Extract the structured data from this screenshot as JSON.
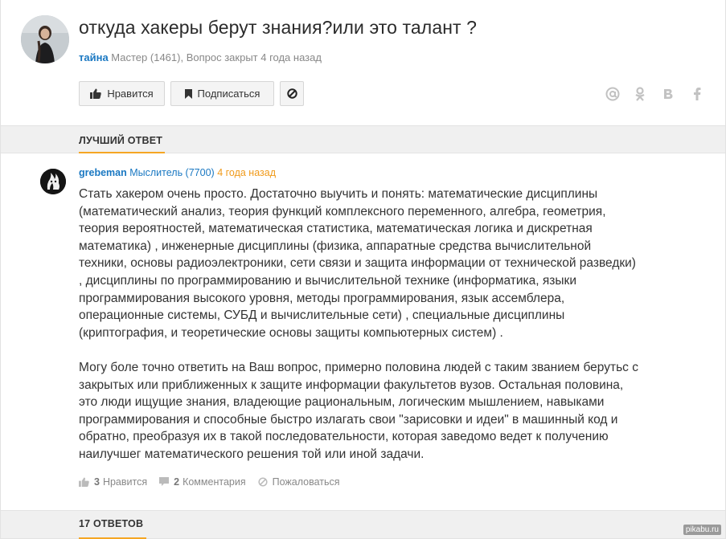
{
  "question": {
    "title": "откуда хакеры берут знания?или это талант ?",
    "author": "тайна",
    "author_rank": "Мастер (1461),",
    "status": "Вопрос закрыт 4 года назад"
  },
  "toolbar": {
    "like_label": "Нравится",
    "subscribe_label": "Подписаться",
    "block_icon": "block-icon"
  },
  "share": {
    "icons": [
      "at-icon",
      "odnoklassniki-icon",
      "vkontakte-icon",
      "facebook-icon"
    ],
    "glyphs": [
      "@",
      "♀",
      "в",
      "f"
    ]
  },
  "best_answer": {
    "section_label": "ЛУЧШИЙ ОТВЕТ",
    "author": "grebeman",
    "author_rank": "Мыслитель (7700)",
    "time": "4 года назад",
    "paragraph1": "Стать хакером очень просто. Достаточно выучить и понять: математические дисциплины (математический анализ, теория функций комплексного переменного, алгебра, геометрия, теория вероятностей, математическая статистика, математическая логика и дискретная математика) , инженерные дисциплины (физика, аппаратные средства вычислительной техники, основы радиоэлектроники, сети связи и защита информации от технической разведки) , дисциплины по программированию и вычислительной технике (информатика, языки программирования высокого уровня, методы программирования, язык ассемблера, операционные системы, СУБД и вычислительные сети) , специальные дисциплины (криптография, и теоретические основы защиты компьютерных систем) .",
    "paragraph2": "Могу боле точно ответить на Ваш вопрос, примерно половина людей с таким званием берутьс с закрытых или приближенных к защите информации факультетов вузов. Остальная половина, это люди ищущие знания, владеющие рациональным, логическим мышлением, навыками программирования и способные быстро излагать свои \"зарисовки и идеи\" в машинный код и обратно, преобразуя их в такой последовательности, которая заведомо ведет к получению наилучшег математического решения той или иной задачи.",
    "likes_count": "3",
    "likes_label": "Нравится",
    "comments_count": "2",
    "comments_label": "Комментария",
    "report_label": "Пожаловаться"
  },
  "answers": {
    "section_label": "17 ОТВЕТОВ"
  },
  "watermark": "pikabu.ru",
  "colors": {
    "link": "#1a78c2",
    "accent": "#f5a623",
    "time": "#f09a1a"
  }
}
